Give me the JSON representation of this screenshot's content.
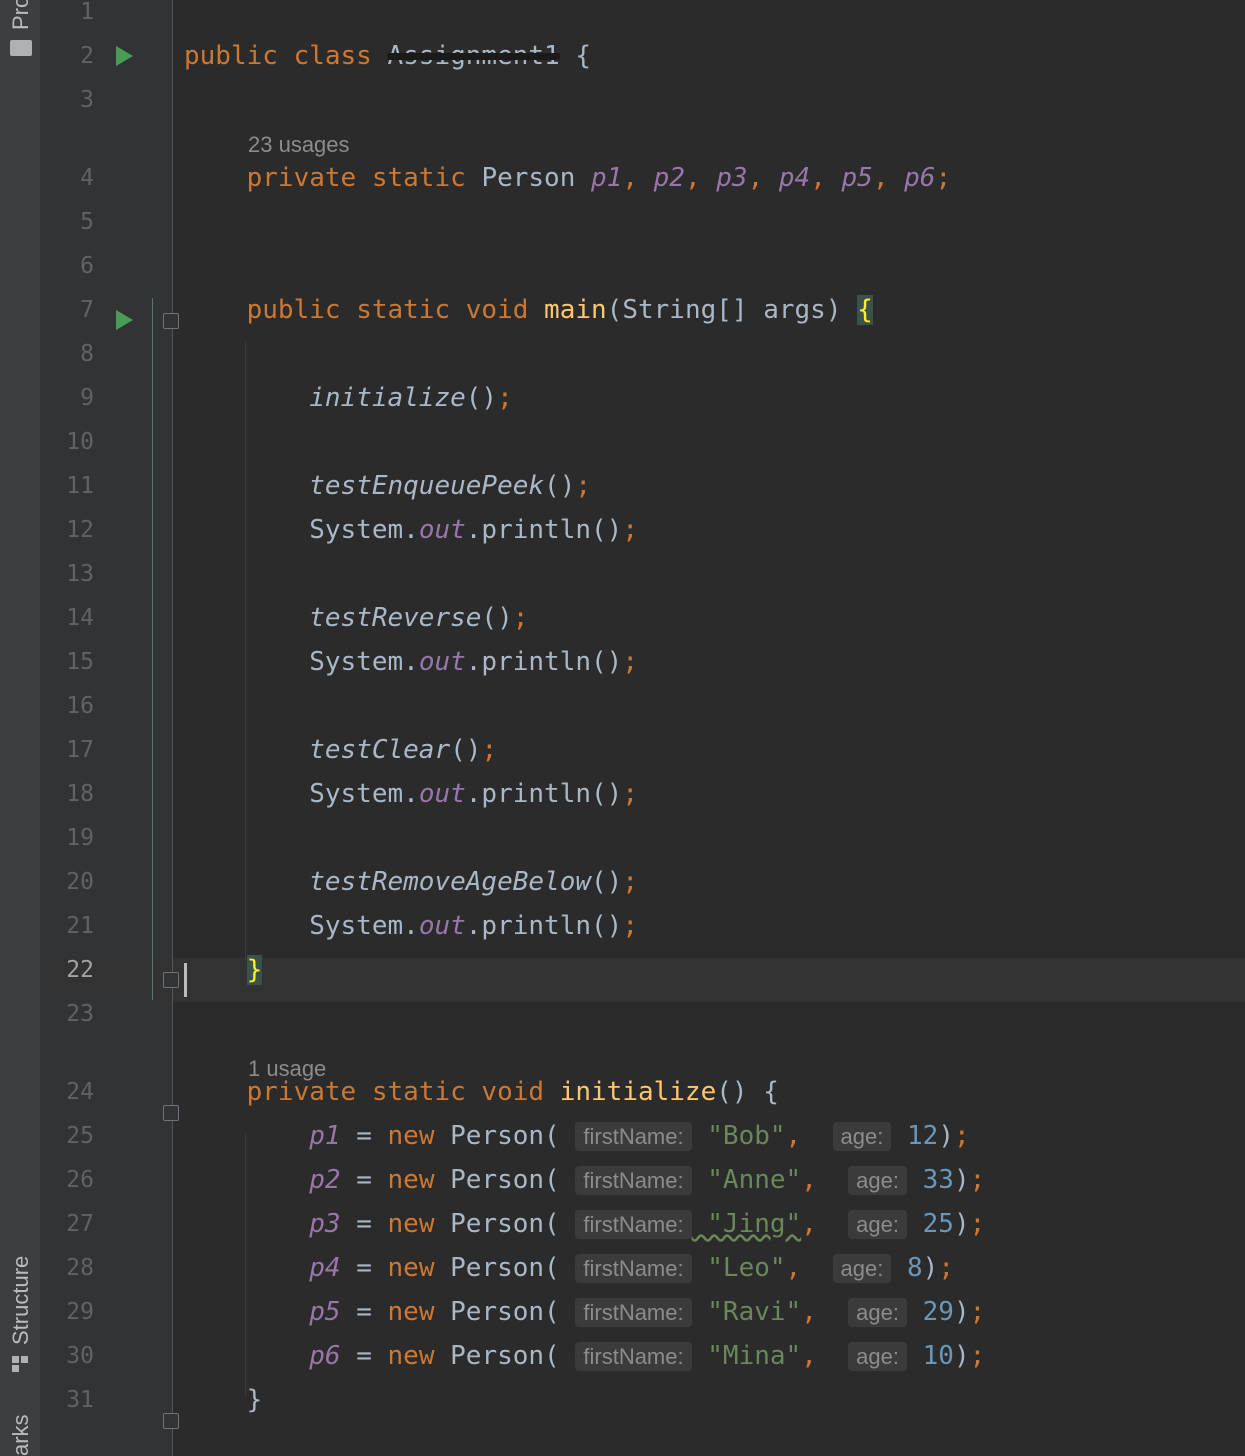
{
  "sidebar": {
    "tabs": [
      "Pro",
      "Structure",
      "arks"
    ]
  },
  "usages": [
    {
      "after_line": 3,
      "text": "23 usages"
    },
    {
      "after_line": 23,
      "text": "1 usage"
    }
  ],
  "current_line": "22",
  "lines": [
    {
      "n": "1",
      "tokens": []
    },
    {
      "n": "2",
      "tokens": [
        [
          "kw",
          "public class "
        ],
        [
          "redact",
          "Assignment1"
        ],
        [
          "p",
          " {"
        ]
      ]
    },
    {
      "n": "3",
      "tokens": []
    },
    {
      "n": "4",
      "tokens": [
        [
          "p",
          "    "
        ],
        [
          "kw",
          "private static "
        ],
        [
          "p",
          "Person "
        ],
        [
          "fld",
          "p1"
        ],
        [
          "kw",
          ", "
        ],
        [
          "fld",
          "p2"
        ],
        [
          "kw",
          ", "
        ],
        [
          "fld",
          "p3"
        ],
        [
          "kw",
          ", "
        ],
        [
          "fld",
          "p4"
        ],
        [
          "kw",
          ", "
        ],
        [
          "fld",
          "p5"
        ],
        [
          "kw",
          ", "
        ],
        [
          "fld",
          "p6"
        ],
        [
          "kw",
          ";"
        ]
      ]
    },
    {
      "n": "5",
      "tokens": []
    },
    {
      "n": "6",
      "tokens": []
    },
    {
      "n": "7",
      "tokens": [
        [
          "p",
          "    "
        ],
        [
          "kw",
          "public static void "
        ],
        [
          "fn",
          "main"
        ],
        [
          "p",
          "(String[] args) "
        ],
        [
          "brace",
          "{"
        ]
      ]
    },
    {
      "n": "8",
      "tokens": []
    },
    {
      "n": "9",
      "tokens": [
        [
          "p",
          "        "
        ],
        [
          "it",
          "initialize"
        ],
        [
          "p",
          "()"
        ],
        [
          "kw",
          ";"
        ]
      ]
    },
    {
      "n": "10",
      "tokens": []
    },
    {
      "n": "11",
      "tokens": [
        [
          "p",
          "        "
        ],
        [
          "it",
          "testEnqueuePeek"
        ],
        [
          "p",
          "()"
        ],
        [
          "kw",
          ";"
        ]
      ]
    },
    {
      "n": "12",
      "tokens": [
        [
          "p",
          "        System."
        ],
        [
          "fld",
          "out"
        ],
        [
          "p",
          ".println()"
        ],
        [
          "kw",
          ";"
        ]
      ]
    },
    {
      "n": "13",
      "tokens": []
    },
    {
      "n": "14",
      "tokens": [
        [
          "p",
          "        "
        ],
        [
          "it",
          "testReverse"
        ],
        [
          "p",
          "()"
        ],
        [
          "kw",
          ";"
        ]
      ]
    },
    {
      "n": "15",
      "tokens": [
        [
          "p",
          "        System."
        ],
        [
          "fld",
          "out"
        ],
        [
          "p",
          ".println()"
        ],
        [
          "kw",
          ";"
        ]
      ]
    },
    {
      "n": "16",
      "tokens": []
    },
    {
      "n": "17",
      "tokens": [
        [
          "p",
          "        "
        ],
        [
          "it",
          "testClear"
        ],
        [
          "p",
          "()"
        ],
        [
          "kw",
          ";"
        ]
      ]
    },
    {
      "n": "18",
      "tokens": [
        [
          "p",
          "        System."
        ],
        [
          "fld",
          "out"
        ],
        [
          "p",
          ".println()"
        ],
        [
          "kw",
          ";"
        ]
      ]
    },
    {
      "n": "19",
      "tokens": []
    },
    {
      "n": "20",
      "tokens": [
        [
          "p",
          "        "
        ],
        [
          "it",
          "testRemoveAgeBelow"
        ],
        [
          "p",
          "()"
        ],
        [
          "kw",
          ";"
        ]
      ]
    },
    {
      "n": "21",
      "tokens": [
        [
          "p",
          "        System."
        ],
        [
          "fld",
          "out"
        ],
        [
          "p",
          ".println()"
        ],
        [
          "kw",
          ";"
        ]
      ]
    },
    {
      "n": "22",
      "tokens": [
        [
          "p",
          "    "
        ],
        [
          "brace",
          "}"
        ]
      ]
    },
    {
      "n": "23",
      "tokens": []
    },
    {
      "n": "24",
      "tokens": [
        [
          "p",
          "    "
        ],
        [
          "kw",
          "private static void "
        ],
        [
          "fn",
          "initialize"
        ],
        [
          "p",
          "() {"
        ]
      ]
    },
    {
      "n": "25",
      "tokens": [
        [
          "p",
          "        "
        ],
        [
          "fld",
          "p1"
        ],
        [
          "p",
          " = "
        ],
        [
          "kw",
          "new "
        ],
        [
          "p",
          "Person( "
        ],
        [
          "hint",
          "firstName:"
        ],
        [
          "str",
          " \"Bob\""
        ],
        [
          "kw",
          ",  "
        ],
        [
          "hint",
          "age:"
        ],
        [
          "num",
          " 12"
        ],
        [
          "p",
          ")"
        ],
        [
          "kw",
          ";"
        ]
      ]
    },
    {
      "n": "26",
      "tokens": [
        [
          "p",
          "        "
        ],
        [
          "fld",
          "p2"
        ],
        [
          "p",
          " = "
        ],
        [
          "kw",
          "new "
        ],
        [
          "p",
          "Person( "
        ],
        [
          "hint",
          "firstName:"
        ],
        [
          "str",
          " \"Anne\""
        ],
        [
          "kw",
          ",  "
        ],
        [
          "hint",
          "age:"
        ],
        [
          "num",
          " 33"
        ],
        [
          "p",
          ")"
        ],
        [
          "kw",
          ";"
        ]
      ]
    },
    {
      "n": "27",
      "tokens": [
        [
          "p",
          "        "
        ],
        [
          "fld",
          "p3"
        ],
        [
          "p",
          " = "
        ],
        [
          "kw",
          "new "
        ],
        [
          "p",
          "Person( "
        ],
        [
          "hint",
          "firstName:"
        ],
        [
          "str",
          " \"Jing\""
        ],
        [
          "kw",
          ",  "
        ],
        [
          "hint",
          "age:"
        ],
        [
          "num",
          " 25"
        ],
        [
          "p",
          ")"
        ],
        [
          "kw",
          ";"
        ]
      ]
    },
    {
      "n": "28",
      "tokens": [
        [
          "p",
          "        "
        ],
        [
          "fld",
          "p4"
        ],
        [
          "p",
          " = "
        ],
        [
          "kw",
          "new "
        ],
        [
          "p",
          "Person( "
        ],
        [
          "hint",
          "firstName:"
        ],
        [
          "str",
          " \"Leo\""
        ],
        [
          "kw",
          ",  "
        ],
        [
          "hint",
          "age:"
        ],
        [
          "num",
          " 8"
        ],
        [
          "p",
          ")"
        ],
        [
          "kw",
          ";"
        ]
      ]
    },
    {
      "n": "29",
      "tokens": [
        [
          "p",
          "        "
        ],
        [
          "fld",
          "p5"
        ],
        [
          "p",
          " = "
        ],
        [
          "kw",
          "new "
        ],
        [
          "p",
          "Person( "
        ],
        [
          "hint",
          "firstName:"
        ],
        [
          "str",
          " \"Ravi\""
        ],
        [
          "kw",
          ",  "
        ],
        [
          "hint",
          "age:"
        ],
        [
          "num",
          " 29"
        ],
        [
          "p",
          ")"
        ],
        [
          "kw",
          ";"
        ]
      ]
    },
    {
      "n": "30",
      "tokens": [
        [
          "p",
          "        "
        ],
        [
          "fld",
          "p6"
        ],
        [
          "p",
          " = "
        ],
        [
          "kw",
          "new "
        ],
        [
          "p",
          "Person( "
        ],
        [
          "hint",
          "firstName:"
        ],
        [
          "str",
          " \"Mina\""
        ],
        [
          "kw",
          ",  "
        ],
        [
          "hint",
          "age:"
        ],
        [
          "num",
          " 10"
        ],
        [
          "p",
          ")"
        ],
        [
          "kw",
          ";"
        ]
      ]
    },
    {
      "n": "31",
      "tokens": [
        [
          "p",
          "    }"
        ]
      ]
    }
  ],
  "colors": {
    "keyword": "#cc7832",
    "field": "#9876aa",
    "function": "#ffc66d",
    "string": "#6a8759",
    "number": "#6897bb",
    "run_icon": "#499c54"
  }
}
